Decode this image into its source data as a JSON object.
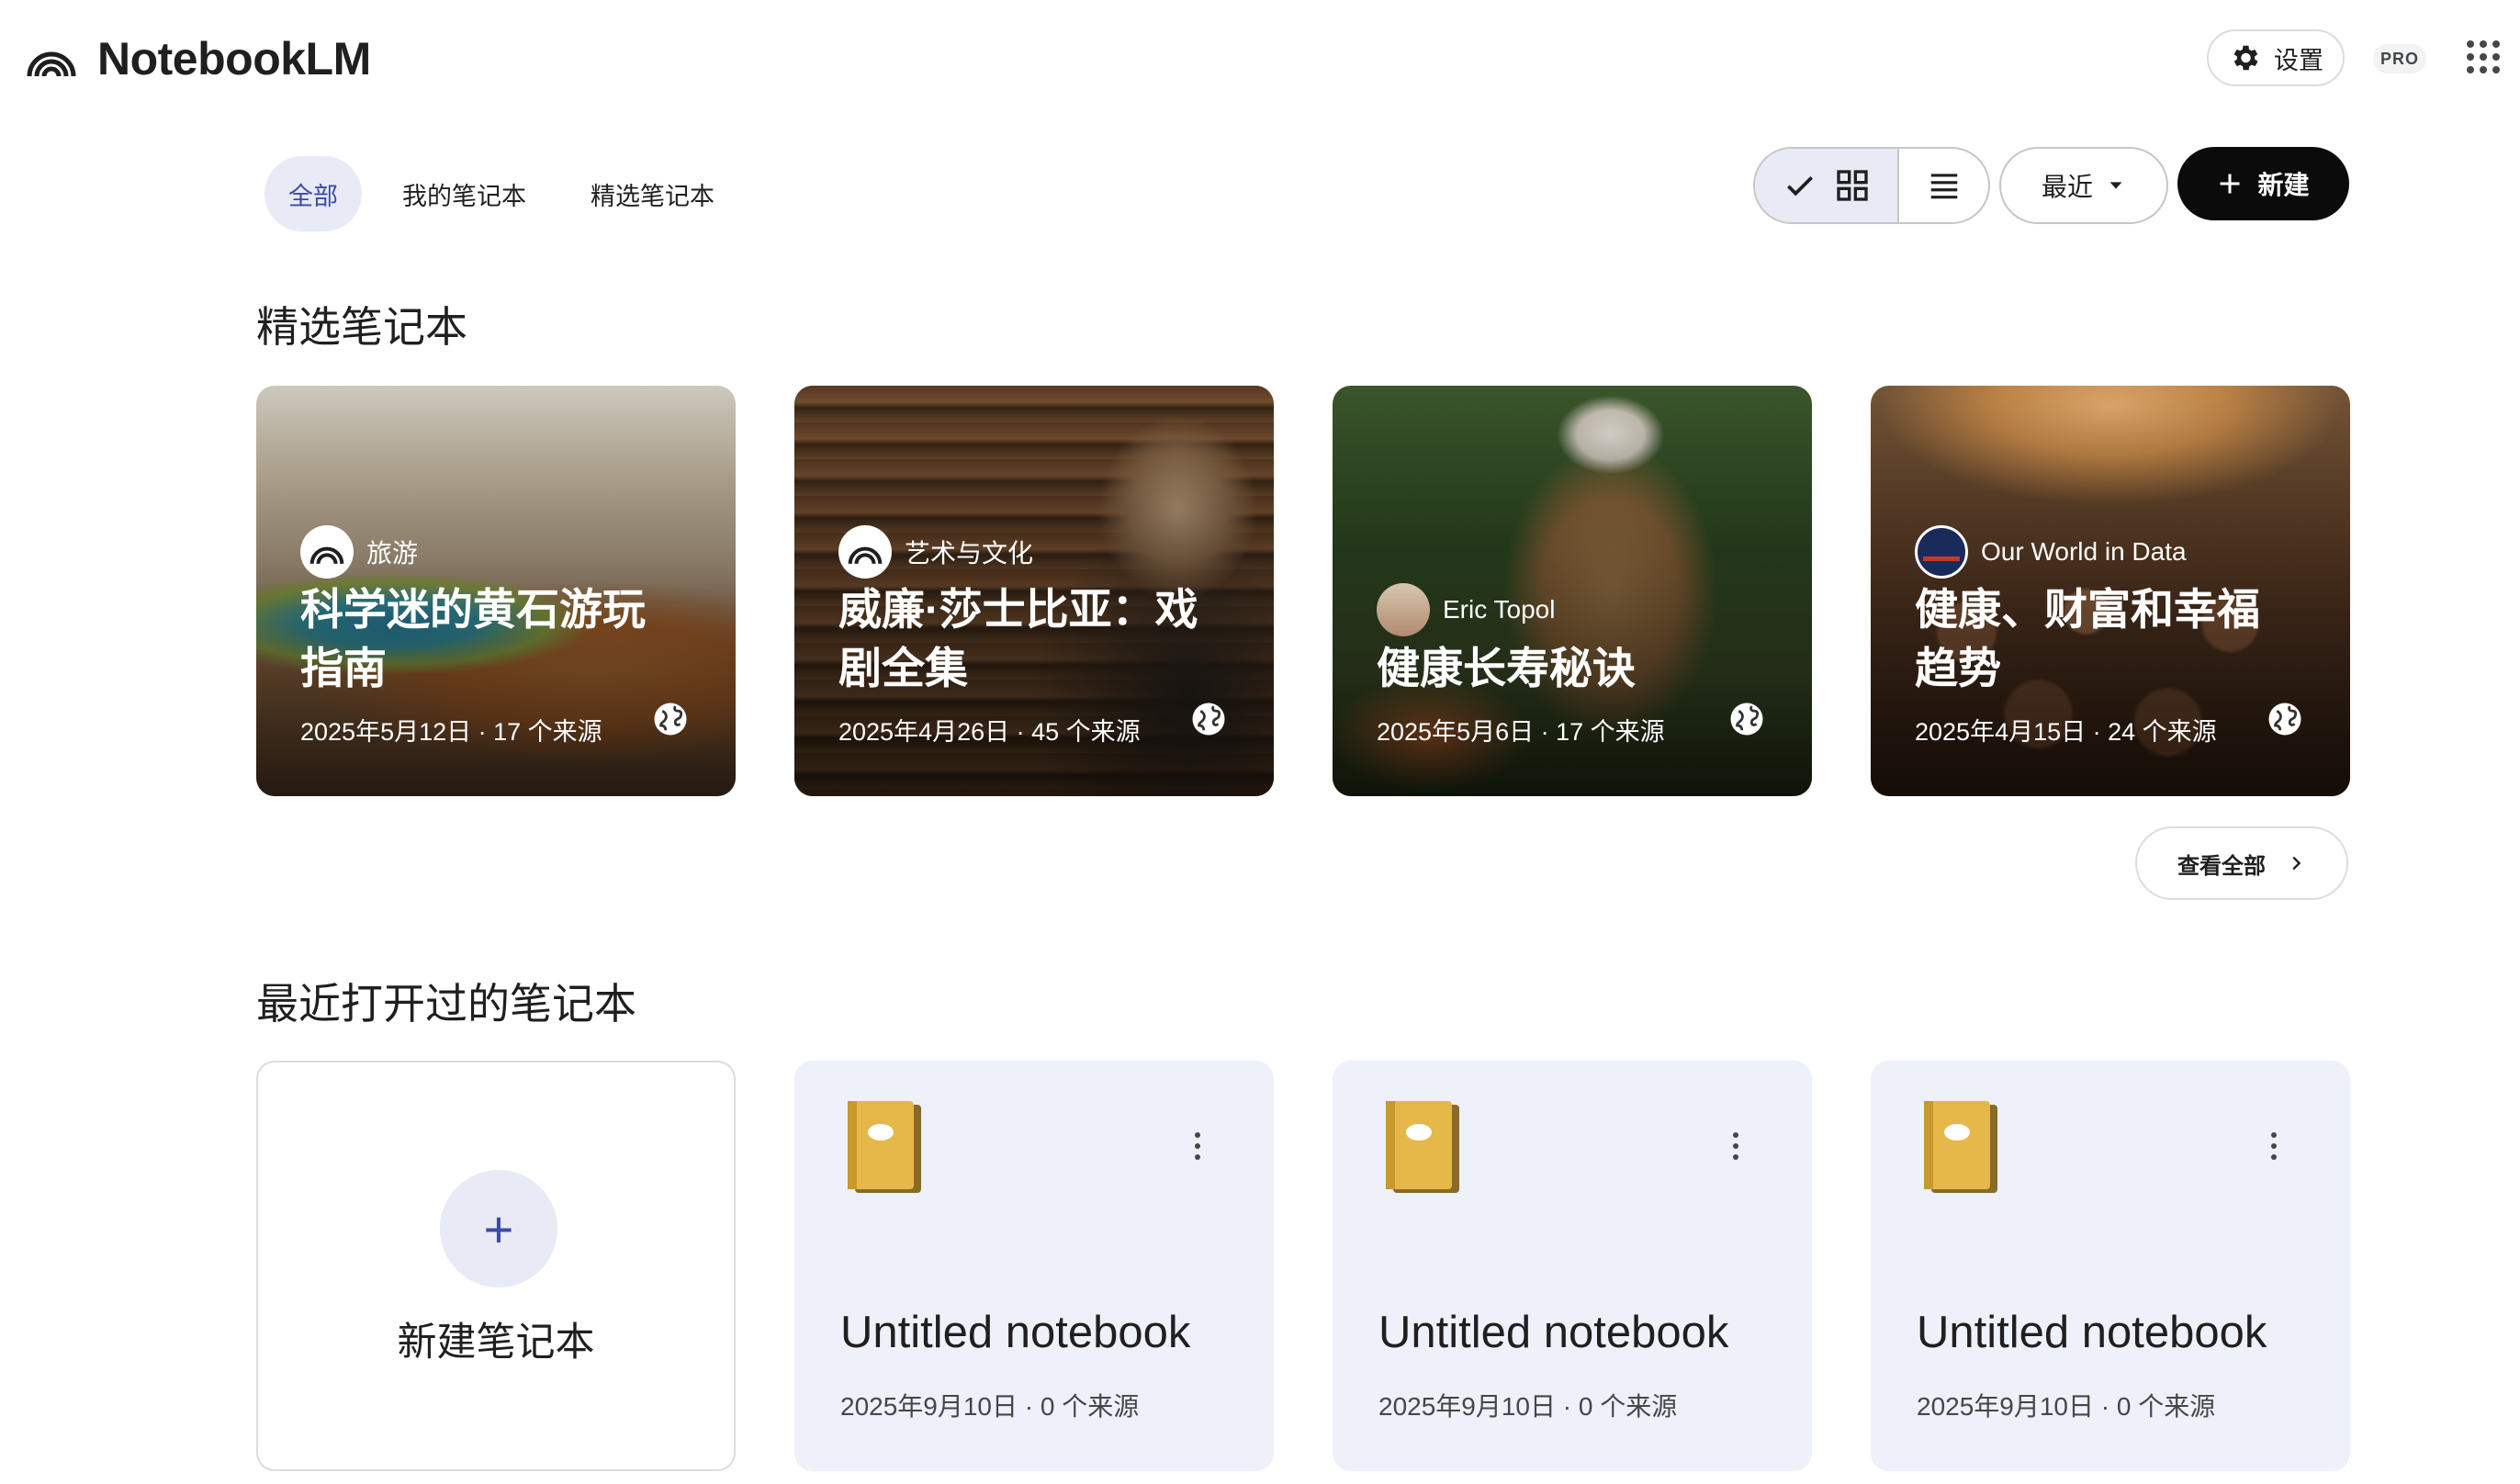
{
  "app": {
    "name": "NotebookLM"
  },
  "header": {
    "settings_label": "设置",
    "plan_badge": "PRO"
  },
  "filters": {
    "tabs": [
      "全部",
      "我的笔记本",
      "精选笔记本"
    ],
    "active": "全部"
  },
  "toolbar": {
    "sort_label": "最近",
    "new_label": "新建",
    "view_mode": "grid"
  },
  "featured": {
    "title": "精选笔记本",
    "view_all_label": "查看全部",
    "cards": [
      {
        "source": "旅游",
        "title": "科学迷的黄石游玩指南",
        "meta": "2025年5月12日 · 17 个来源"
      },
      {
        "source": "艺术与文化",
        "title": "威廉·莎士比亚：戏剧全集",
        "meta": "2025年4月26日 · 45 个来源"
      },
      {
        "source": "Eric Topol",
        "title": "健康长寿秘诀",
        "meta": "2025年5月6日 · 17 个来源"
      },
      {
        "source": "Our World in Data",
        "title": "健康、财富和幸福趋势",
        "meta": "2025年4月15日 · 24 个来源"
      }
    ]
  },
  "recent": {
    "title": "最近打开过的笔记本",
    "new_card_label": "新建笔记本",
    "notebooks": [
      {
        "title": "Untitled notebook",
        "meta": "2025年9月10日 · 0 个来源"
      },
      {
        "title": "Untitled notebook",
        "meta": "2025年9月10日 · 0 个来源"
      },
      {
        "title": "Untitled notebook",
        "meta": "2025年9月10日 · 0 个来源"
      }
    ]
  }
}
